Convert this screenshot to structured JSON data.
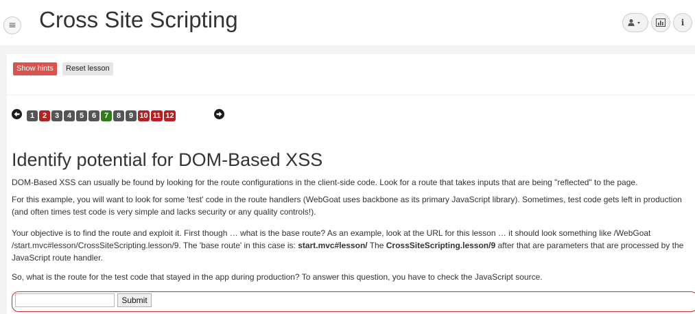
{
  "header": {
    "title": "Cross Site Scripting",
    "menu_icon": "hamburger-icon",
    "icons": [
      "user-icon",
      "caret-down-icon",
      "chart-icon",
      "info-icon"
    ],
    "info_glyph": "i"
  },
  "toolbar": {
    "show_hints_label": "Show hints",
    "reset_lesson_label": "Reset lesson"
  },
  "pager": {
    "pages": [
      {
        "label": "1",
        "state": "gray"
      },
      {
        "label": "2",
        "state": "red"
      },
      {
        "label": "3",
        "state": "gray"
      },
      {
        "label": "4",
        "state": "gray"
      },
      {
        "label": "5",
        "state": "gray"
      },
      {
        "label": "6",
        "state": "gray"
      },
      {
        "label": "7",
        "state": "green"
      },
      {
        "label": "8",
        "state": "gray"
      },
      {
        "label": "9",
        "state": "gray"
      },
      {
        "label": "10",
        "state": "red"
      },
      {
        "label": "11",
        "state": "red"
      },
      {
        "label": "12",
        "state": "red"
      }
    ]
  },
  "lesson": {
    "heading": "Identify potential for DOM-Based XSS",
    "p1": "DOM-Based XSS can usually be found by looking for the route configurations in the client-side code. Look for a route that takes inputs that are being \"reflected\" to the page.",
    "p2": "For this example, you will want to look for some 'test' code in the route handlers (WebGoat uses backbone as its primary JavaScript library). Sometimes, test code gets left in production (and often times test code is very simple and lacks security or any quality controls!).",
    "p3_a": "Your objective is to find the route and exploit it. First though … what is the base route? As an example, look at the URL for this lesson … it should look something like /WebGoat /start.mvc#lesson/CrossSiteScripting.lesson/9. The 'base route' in this case is: ",
    "p3_b": "start.mvc#lesson/",
    "p3_c": " The ",
    "p3_d": "CrossSiteScripting.lesson/9",
    "p3_e": " after that are parameters that are processed by the JavaScript route handler.",
    "p4": "So, what is the route for the test code that stayed in the app during production? To answer this question, you have to check the JavaScript source."
  },
  "form": {
    "input_value": "",
    "submit_label": "Submit"
  },
  "colors": {
    "danger": "#d9534f",
    "page_red": "#b32121",
    "page_green": "#2e7d18",
    "page_gray": "#555555"
  }
}
